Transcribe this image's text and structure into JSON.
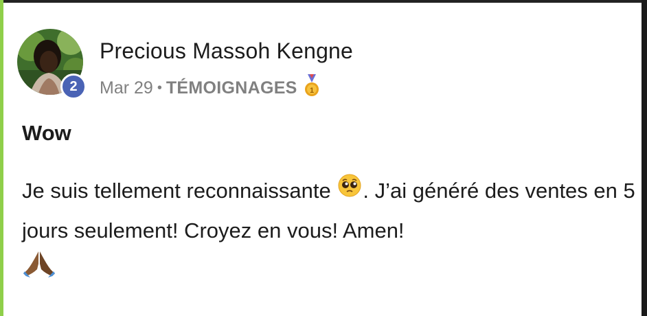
{
  "post": {
    "author": "Precious Massoh Kengne",
    "level": "2",
    "date": "Mar 29",
    "separator": "•",
    "category": "TÉMOIGNAGES",
    "title": "Wow",
    "body_part1": "Je suis tellement reconnaissante",
    "body_part2": ". J’ai généré des ventes en 5 jours seulement! Croyez en vous! Amen!"
  },
  "icons": {
    "medal": "first-place-medal-icon",
    "inline_emoji": "pleading-face-emoji-icon",
    "trailing_emoji": "folded-hands-emoji-icon"
  },
  "colors": {
    "level_badge": "#4a63b5",
    "meta_text": "#808080",
    "body_text": "#1c1c1c",
    "frame_left": "#8fcf4a"
  }
}
